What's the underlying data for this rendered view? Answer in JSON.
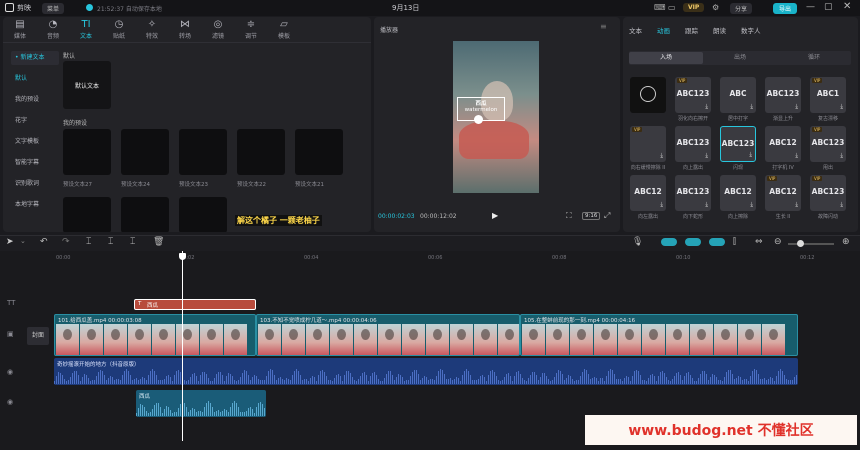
{
  "titlebar": {
    "app_name": "剪映",
    "menu": "菜单",
    "autosave": "21:52:37 自动保存本地",
    "project_title": "9月13日",
    "vip": "VIP",
    "share": "分享",
    "export": "导出"
  },
  "media_toolbar": [
    {
      "label": "媒体",
      "icon": "media-icon"
    },
    {
      "label": "音频",
      "icon": "audio-icon"
    },
    {
      "label": "文本",
      "icon": "text-icon"
    },
    {
      "label": "贴纸",
      "icon": "sticker-icon"
    },
    {
      "label": "特效",
      "icon": "effects-icon"
    },
    {
      "label": "转场",
      "icon": "transition-icon"
    },
    {
      "label": "滤镜",
      "icon": "filter-icon"
    },
    {
      "label": "调节",
      "icon": "adjust-icon"
    },
    {
      "label": "模板",
      "icon": "template-icon"
    }
  ],
  "text_sidebar": [
    "• 新建文本",
    "默认",
    "我的预设",
    "花字",
    "文字模板",
    "智能字幕",
    "识别歌词",
    "本地字幕"
  ],
  "default_section": {
    "heading": "默认",
    "tile_label": "默认文本"
  },
  "presets_section": {
    "heading": "我的预设",
    "row1": [
      "预设文本27",
      "预设文本24",
      "预设文本23",
      "预设文本22",
      "预设文本21"
    ]
  },
  "bottom_strip_text": "解这个橘子  一颗老柚子",
  "player": {
    "title": "播放器",
    "current_time": "00:00:02:03",
    "total_time": "00:00:12:02",
    "watermark_line1": "西瓜",
    "watermark_line2": "watermelon",
    "ratio": "9:16"
  },
  "inspector": {
    "tabs": [
      "文本",
      "动画",
      "跟踪",
      "朗读",
      "数字人"
    ],
    "active_tab": "动画",
    "subtabs": [
      "入场",
      "出场",
      "循环"
    ],
    "active_subtab": "入场",
    "tiles": [
      {
        "text": "",
        "cap": "",
        "vip": false,
        "type": "none"
      },
      {
        "text": "ABC123",
        "cap": "羽化向右擦开",
        "vip": true
      },
      {
        "text": "ABC",
        "cap": "居中打字",
        "vip": false
      },
      {
        "text": "ABC123",
        "cap": "渐显上升",
        "vip": false
      },
      {
        "text": "ABC1",
        "cap": "复古漂移",
        "vip": true
      },
      {
        "text": "",
        "cap": "向右缓慢擦除 II",
        "vip": true
      },
      {
        "text": "ABC123",
        "cap": "向上露出",
        "vip": false
      },
      {
        "text": "ABC123",
        "cap": "闪现",
        "vip": false,
        "selected": true
      },
      {
        "text": "ABC12",
        "cap": "打字机 IV",
        "vip": false
      },
      {
        "text": "ABC123",
        "cap": "甩出",
        "vip": true
      },
      {
        "text": "ABC12",
        "cap": "向左露出",
        "vip": false
      },
      {
        "text": "ABC123",
        "cap": "向下蛇形",
        "vip": false
      },
      {
        "text": "ABC12",
        "cap": "向上擦除",
        "vip": false
      },
      {
        "text": "ABC12",
        "cap": "生长 II",
        "vip": true
      },
      {
        "text": "ABC123",
        "cap": "故障闪动",
        "vip": true
      }
    ]
  },
  "timeline": {
    "ruler": [
      "00:00",
      "00:02",
      "00:04",
      "00:06",
      "00:08",
      "00:10",
      "00:12"
    ],
    "cover_label": "封面",
    "text_clip": "西瓜",
    "video_clips": [
      {
        "label": "101.给西瓜盖.mp4  00:00:03:08"
      },
      {
        "label": "103.不知不觉喷成柠几道～.mp4  00:00:04:06"
      },
      {
        "label": "105.在整蚌前现的那一刻.mp4  00:00:04:16"
      }
    ],
    "audio_clip": "奇妙摇滚开始的地方（抖音原版）",
    "sfx_clip": "西瓜"
  },
  "footer_watermark": "www.budog.net 不懂社区",
  "colors": {
    "accent": "#28c6dd",
    "text_clip": "#b84b3c",
    "video_track": "#175d6c",
    "audio_track": "#1d3a7a"
  }
}
